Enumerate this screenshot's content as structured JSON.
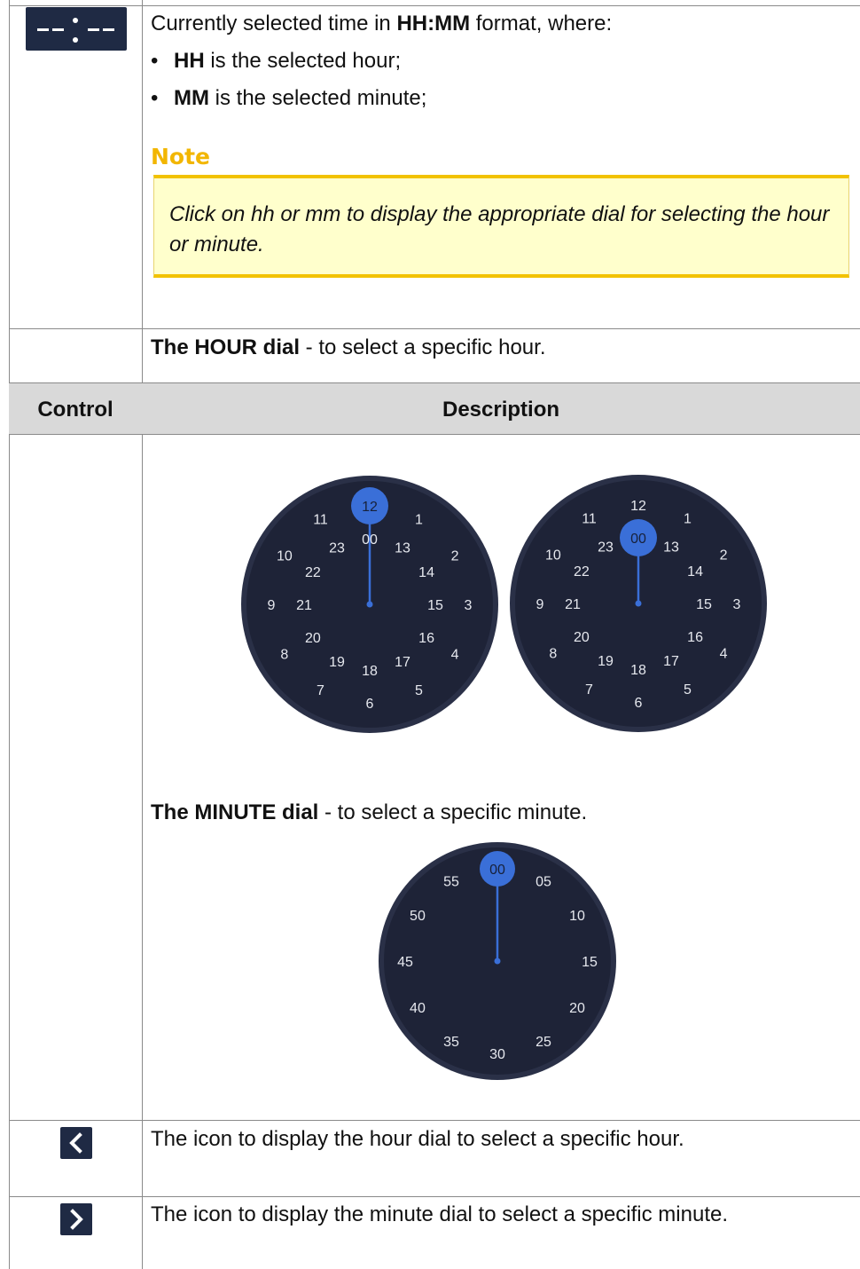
{
  "row_time": {
    "control_icon": "time-display-icon",
    "intro_pre": "Currently selected time in ",
    "intro_bold": "HH:MM",
    "intro_post": " format, where:",
    "bullets": [
      {
        "bold": "HH",
        "text": " is the selected hour;"
      },
      {
        "bold": "MM",
        "text": " is the selected minute;"
      }
    ],
    "note_title": "Note",
    "note_text": "Click on hh or mm to display the appropriate dial for selecting the hour or minute."
  },
  "row_hour_caption": {
    "bold": "The HOUR dial",
    "text": " - to select a specific hour."
  },
  "table_header": {
    "control": "Control",
    "description": "Description"
  },
  "hour_dials": [
    {
      "selected": "12",
      "outer": [
        "12",
        "1",
        "2",
        "3",
        "4",
        "5",
        "6",
        "7",
        "8",
        "9",
        "10",
        "11"
      ],
      "inner": [
        "00",
        "13",
        "14",
        "15",
        "16",
        "17",
        "18",
        "19",
        "20",
        "21",
        "22",
        "23"
      ]
    },
    {
      "selected": "00",
      "outer": [
        "12",
        "1",
        "2",
        "3",
        "4",
        "5",
        "6",
        "7",
        "8",
        "9",
        "10",
        "11"
      ],
      "inner": [
        "00",
        "13",
        "14",
        "15",
        "16",
        "17",
        "18",
        "19",
        "20",
        "21",
        "22",
        "23"
      ]
    }
  ],
  "minute_caption": {
    "bold": "The MINUTE dial",
    "text": " - to select a specific minute."
  },
  "minute_dial": {
    "selected": "00",
    "labels": [
      "00",
      "05",
      "10",
      "15",
      "20",
      "25",
      "30",
      "35",
      "40",
      "45",
      "50",
      "55"
    ]
  },
  "row_prev": {
    "icon": "chevron-left-icon",
    "text": "The icon to display the hour dial to select a specific hour."
  },
  "row_next": {
    "icon": "chevron-right-icon",
    "text": "The icon to display the minute dial to select a specific minute."
  },
  "colors": {
    "dial_bg": "#1e2337",
    "dial_ring": "#2a3047",
    "accent": "#3a6fd8",
    "label": "#e6e8ee",
    "note_border": "#f2c200",
    "note_bg": "#ffffcc",
    "note_title": "#f2b600"
  }
}
